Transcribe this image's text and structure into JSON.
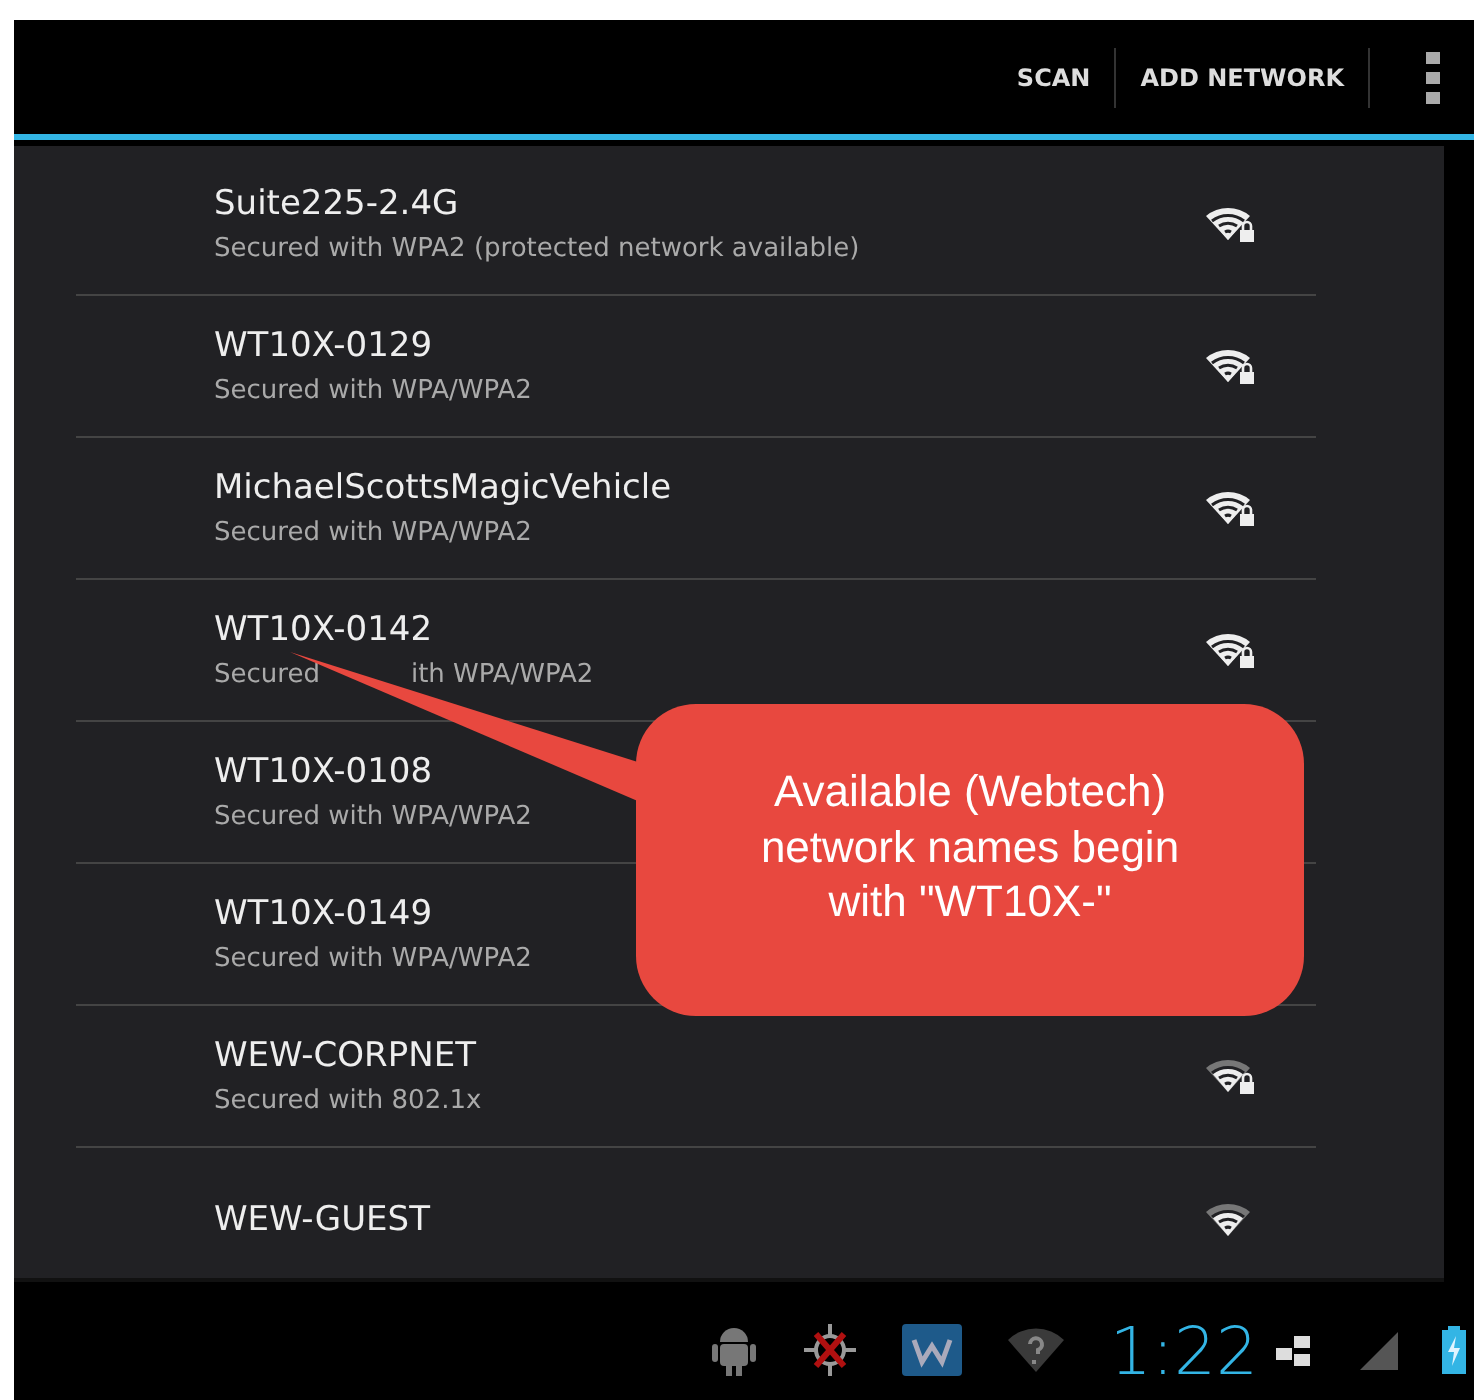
{
  "action_bar": {
    "actions": [
      {
        "label": "SCAN"
      },
      {
        "label": "ADD NETWORK"
      }
    ]
  },
  "networks": [
    {
      "name": "Suite225-2.4G",
      "status": "Secured with WPA2 (protected network available)",
      "weak": false,
      "secured": true
    },
    {
      "name": "WT10X-0129",
      "status": "Secured with WPA/WPA2",
      "weak": false,
      "secured": true
    },
    {
      "name": "MichaelScottsMagicVehicle",
      "status": "Secured with WPA/WPA2",
      "weak": false,
      "secured": true
    },
    {
      "name": "WT10X-0142",
      "status": [
        "Secured",
        "ith WPA/WPA2"
      ],
      "weak": false,
      "secured": true
    },
    {
      "name": "WT10X-0108",
      "status": "Secured with WPA/WPA2"
    },
    {
      "name": "WT10X-0149",
      "status": "Secured with WPA/WPA2"
    },
    {
      "name": "WEW-CORPNET",
      "status": "Secured with 802.1x",
      "weak": true,
      "secured": true
    },
    {
      "name": "WEW-GUEST",
      "weak": true,
      "secured": false
    }
  ],
  "callout": {
    "text": "Available (Webtech) network names begin with \"WT10X-\""
  },
  "status_bar": {
    "time": "1:22"
  }
}
